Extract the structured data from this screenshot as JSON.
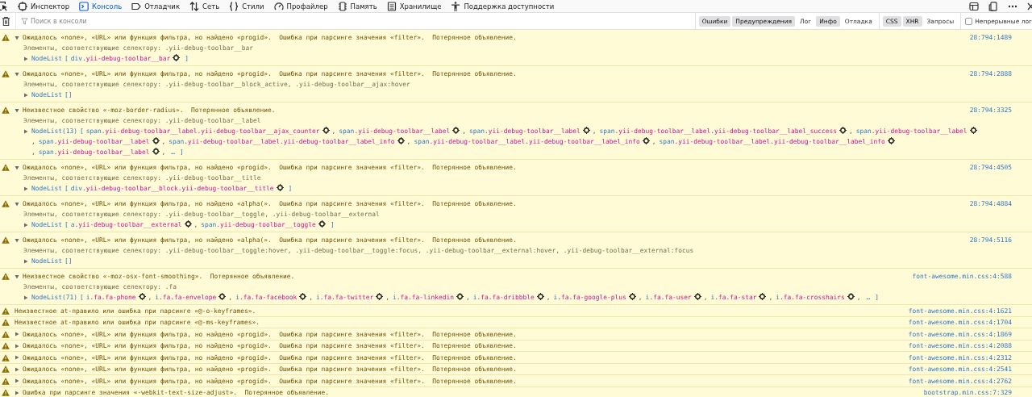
{
  "tabs": [
    {
      "label": "Инспектор",
      "selected": false
    },
    {
      "label": "Консоль",
      "selected": true
    },
    {
      "label": "Отладчик",
      "selected": false
    },
    {
      "label": "Сеть",
      "selected": false
    },
    {
      "label": "Стили",
      "selected": false
    },
    {
      "label": "Профайлер",
      "selected": false
    },
    {
      "label": "Память",
      "selected": false
    },
    {
      "label": "Хранилище",
      "selected": false
    },
    {
      "label": "Поддержка доступности",
      "selected": false
    }
  ],
  "search": {
    "placeholder": "Поиск в консоли"
  },
  "level_filters": [
    {
      "label": "Ошибки",
      "selected": true
    },
    {
      "label": "Предупреждения",
      "selected": true
    },
    {
      "label": "Лог",
      "selected": false
    },
    {
      "label": "Инфо",
      "selected": true
    },
    {
      "label": "Отладка",
      "selected": false
    }
  ],
  "request_filters": [
    {
      "label": "CSS",
      "selected": true
    },
    {
      "label": "XHR",
      "selected": true
    },
    {
      "label": "Запросы",
      "selected": false
    }
  ],
  "persist_logs": {
    "label": "Непрерывные лог",
    "checked": false
  },
  "messages": [
    {
      "expanded": true,
      "text": "Ожидалось «none», «URL» или функция фильтра, но найдено «progid».  Ошибка при парсинге значения «filter».  Потерянное объявление.",
      "location": "28:794:1489",
      "selector": "Элементы, соответствующие селектору: .yii-debug-toolbar__bar",
      "nodelist": {
        "label": "NodeList",
        "open": "[",
        "items": [
          {
            "tag": "div",
            "cls": ".yii-debug-toolbar__bar"
          }
        ],
        "close": "]"
      }
    },
    {
      "expanded": true,
      "text": "Ожидалось «none», «URL» или функция фильтра, но найдено «progid».  Ошибка при парсинге значения «filter».  Потерянное объявление.",
      "location": "28:794:2888",
      "selector": "Элементы, соответствующие селектору: .yii-debug-toolbar__block_active, .yii-debug-toolbar__ajax:hover",
      "nodelist": {
        "label": "NodeList",
        "open": "[]"
      }
    },
    {
      "expanded": true,
      "text": "Неизвестное свойство «-moz-border-radius».  Потерянное объявление.",
      "location": "28:794:3325",
      "selector": "Элементы, соответствующие селектору: .yii-debug-toolbar__label",
      "nodelist": {
        "label": "NodeList(13)",
        "open": "[",
        "separator": ",",
        "items": [
          {
            "tag": "span",
            "cls": ".yii-debug-toolbar__label.yii-debug-toolbar__ajax_counter"
          },
          {
            "tag": "span",
            "cls": ".yii-debug-toolbar__label"
          },
          {
            "tag": "span",
            "cls": ".yii-debug-toolbar__label"
          },
          {
            "tag": "span",
            "cls": ".yii-debug-toolbar__label.yii-debug-toolbar__label_success"
          },
          {
            "tag": "span",
            "cls": ".yii-debug-toolbar__label"
          },
          {
            "tag": "span",
            "cls": ".yii-debug-toolbar__label"
          },
          {
            "tag": "span",
            "cls": ".yii-debug-toolbar__label.yii-debug-toolbar__label_info"
          },
          {
            "tag": "span",
            "cls": ".yii-debug-toolbar__label.yii-debug-toolbar__label_info"
          },
          {
            "tag": "span",
            "cls": ".yii-debug-toolbar__label.yii-debug-toolbar__label_info"
          },
          {
            "tag": "span",
            "cls": ".yii-debug-toolbar__label"
          }
        ],
        "more": "…",
        "close": "]"
      }
    },
    {
      "expanded": true,
      "text": "Ожидалось «none», «URL» или функция фильтра, но найдено «progid».  Ошибка при парсинге значения «filter».  Потерянное объявление.",
      "location": "28:794:4505",
      "selector": "Элементы, соответствующие селектору: .yii-debug-toolbar__title",
      "nodelist": {
        "label": "NodeList",
        "open": "[",
        "items": [
          {
            "tag": "div",
            "cls": ".yii-debug-toolbar__block.yii-debug-toolbar__title"
          }
        ],
        "close": "]"
      }
    },
    {
      "expanded": true,
      "text": "Ожидалось «none», «URL» или функция фильтра, но найдено «alpha(».  Ошибка при парсинге значения «filter».  Потерянное объявление.",
      "location": "28:794:4884",
      "selector": "Элементы, соответствующие селектору: .yii-debug-toolbar__toggle, .yii-debug-toolbar__external",
      "nodelist": {
        "label": "NodeList",
        "open": "[",
        "separator": ",",
        "items": [
          {
            "tag": "a",
            "cls": ".yii-debug-toolbar__external"
          },
          {
            "tag": "span",
            "cls": ".yii-debug-toolbar__toggle"
          }
        ],
        "close": "]"
      }
    },
    {
      "expanded": true,
      "text": "Ожидалось «none», «URL» или функция фильтра, но найдено «alpha(».  Ошибка при парсинге значения «filter».  Потерянное объявление.",
      "location": "28:794:5116",
      "selector": "Элементы, соответствующие селектору: .yii-debug-toolbar__toggle:hover, .yii-debug-toolbar__toggle:focus, .yii-debug-toolbar__external:hover, .yii-debug-toolbar__external:focus",
      "nodelist": {
        "label": "NodeList",
        "open": "[]"
      }
    },
    {
      "expanded": true,
      "text": "Неизвестное свойство «-moz-osx-font-smoothing».  Потерянное объявление.",
      "location": "font-awesome.min.css:4:588",
      "selector": "Элементы, соответствующие селектору: .fa",
      "nodelist": {
        "label": "NodeList(71)",
        "open": "[",
        "separator": ",",
        "items": [
          {
            "tag": "i",
            "cls": ".fa.fa-phone"
          },
          {
            "tag": "i",
            "cls": ".fa.fa-envelope"
          },
          {
            "tag": "i",
            "cls": ".fa.fa-facebook"
          },
          {
            "tag": "i",
            "cls": ".fa.fa-twitter"
          },
          {
            "tag": "i",
            "cls": ".fa.fa-linkedin"
          },
          {
            "tag": "i",
            "cls": ".fa.fa-dribbble"
          },
          {
            "tag": "i",
            "cls": ".fa.fa-google-plus"
          },
          {
            "tag": "i",
            "cls": ".fa.fa-user"
          },
          {
            "tag": "i",
            "cls": ".fa.fa-star"
          },
          {
            "tag": "i",
            "cls": ".fa.fa-crosshairs"
          }
        ],
        "more": "…",
        "close": "]"
      }
    },
    {
      "text": "Неизвестное at-правило или ошибка при парсинге «@-o-keyframes».",
      "location": "font-awesome.min.css:4:1621"
    },
    {
      "text": "Неизвестное at-правило или ошибка при парсинге «@-ms-keyframes».",
      "location": "font-awesome.min.css:4:1704"
    },
    {
      "expanded": false,
      "text": "Ожидалось «none», «URL» или функция фильтра, но найдено «progid».  Ошибка при парсинге значения «filter».  Потерянное объявление.",
      "location": "font-awesome.min.css:4:1869"
    },
    {
      "expanded": false,
      "text": "Ожидалось «none», «URL» или функция фильтра, но найдено «progid».  Ошибка при парсинге значения «filter».  Потерянное объявление.",
      "location": "font-awesome.min.css:4:2088"
    },
    {
      "expanded": false,
      "text": "Ожидалось «none», «URL» или функция фильтра, но найдено «progid».  Ошибка при парсинге значения «filter».  Потерянное объявление.",
      "location": "font-awesome.min.css:4:2312"
    },
    {
      "expanded": false,
      "text": "Ожидалось «none», «URL» или функция фильтра, но найдено «progid».  Ошибка при парсинге значения «filter».  Потерянное объявление.",
      "location": "font-awesome.min.css:4:2541"
    },
    {
      "expanded": false,
      "text": "Ожидалось «none», «URL» или функция фильтра, но найдено «progid».  Ошибка при парсинге значения «filter».  Потерянное объявление.",
      "location": "font-awesome.min.css:4:2762"
    },
    {
      "expanded": false,
      "text": "Ошибка при парсинге значения «-webkit-text-size-adjust».  Потерянное объявление.",
      "location": "bootstrap.min.css:7:329"
    }
  ]
}
